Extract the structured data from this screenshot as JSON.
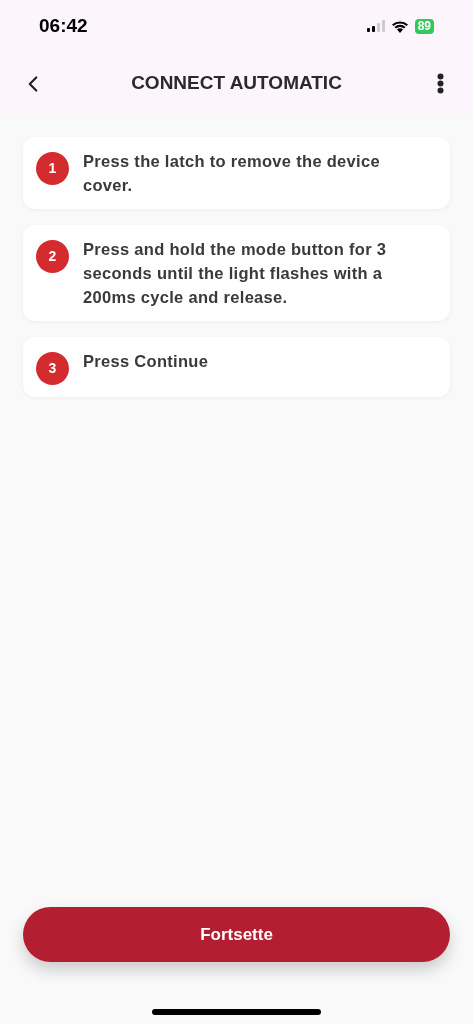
{
  "status_bar": {
    "time": "06:42",
    "battery": "89"
  },
  "header": {
    "title": "CONNECT AUTOMATIC"
  },
  "steps": [
    {
      "number": "1",
      "text": "Press the latch to remove the device cover."
    },
    {
      "number": "2",
      "text": "Press and hold the mode button for 3 seconds until the light flashes with a 200ms cycle and release."
    },
    {
      "number": "3",
      "text": "Press Continue"
    }
  ],
  "continue_button": {
    "label": "Fortsette"
  }
}
